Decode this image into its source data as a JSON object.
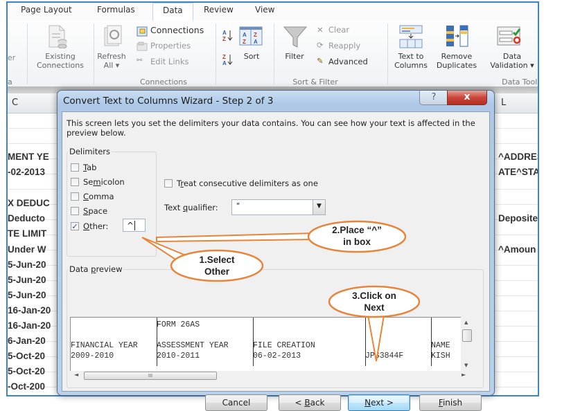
{
  "ribbon": {
    "tabs": [
      {
        "label": "Page Layout"
      },
      {
        "label": "Formulas"
      },
      {
        "label": "Data",
        "active": true
      },
      {
        "label": "Review"
      },
      {
        "label": "View"
      }
    ],
    "partial_left_label": "er",
    "partial_left_group": "a",
    "existing_connections": "Existing\nConnections",
    "existing_connections_line1": "Existing",
    "existing_connections_line2": "Connections",
    "refresh_all_line1": "Refresh",
    "refresh_all_line2": "All ▾",
    "connections": "Connections",
    "properties": "Properties",
    "edit_links": "Edit Links",
    "group_connections": "Connections",
    "sort_label": "Sort",
    "filter_label": "Filter",
    "clear_label": "Clear",
    "reapply_label": "Reapply",
    "advanced_label": "Advanced",
    "group_sort_filter": "Sort & Filter",
    "text_to_columns_line1": "Text to",
    "text_to_columns_line2": "Columns",
    "remove_duplicates_line1": "Remove",
    "remove_duplicates_line2": "Duplicates",
    "data_validation_line1": "Data",
    "data_validation_line2": "Validation ▾",
    "group_data_tools": "Data Tools"
  },
  "sheet": {
    "col_left": "C",
    "col_right": "L",
    "left_cells": [
      "MENT YE",
      "-02-2013",
      "X DEDUC",
      "Deducto",
      "TE LIMIT",
      "Under W",
      "5-Jun-20",
      "5-Jun-20",
      "5-Jun-20",
      "16-Jan-20",
      "16-Jan-20",
      "6-Jan-20",
      "5-Oct-20",
      "5-Oct-20",
      "-Oct-200"
    ],
    "right_cells": [
      "^ADDRES",
      "ATE^STA",
      "Deposite",
      "^Amoun"
    ]
  },
  "dialog": {
    "title": "Convert Text to Columns Wizard - Step 2 of 3",
    "help_glyph": "?",
    "close_glyph": "x",
    "intro": "This screen lets you set the delimiters your data contains.  You can see how your text is affected in the preview below.",
    "delimiters_legend": "Delimiters",
    "delimiters": [
      {
        "label": "Tab",
        "checked": false
      },
      {
        "label": "Semicolon",
        "checked": false
      },
      {
        "label": "Comma",
        "checked": false
      },
      {
        "label": "Space",
        "checked": false
      },
      {
        "label": "Other:",
        "checked": true
      }
    ],
    "other_value": "^",
    "treat_consecutive_label": "Treat consecutive delimiters as one",
    "treat_consecutive_checked": false,
    "text_qualifier_label": "Text qualifier:",
    "text_qualifier_value": "\"",
    "data_preview_legend": "Data preview",
    "preview": {
      "columns": [
        {
          "lines": [
            "",
            "",
            "FINANCIAL YEAR",
            "2009-2010"
          ]
        },
        {
          "lines": [
            "FORM 26AS",
            "",
            "ASSESSMENT YEAR",
            "2010-2011"
          ]
        },
        {
          "lines": [
            "",
            "",
            "FILE CREATION",
            "06-02-2013"
          ]
        },
        {
          "lines": [
            "",
            "",
            "",
            "JPS3844F"
          ]
        },
        {
          "lines": [
            "",
            "",
            "NAME",
            "KISH"
          ]
        }
      ]
    },
    "buttons": {
      "cancel": "Cancel",
      "back": "< Back",
      "next": "Next >",
      "finish": "Finish"
    }
  },
  "annotations": {
    "step1_line1": "1.Select",
    "step1_line2": "Other",
    "step2_line1": "2.Place “^”",
    "step2_line2": "in box",
    "step3_line1": "3.Click on",
    "step3_line2": "Next",
    "color": "#e8843a"
  }
}
